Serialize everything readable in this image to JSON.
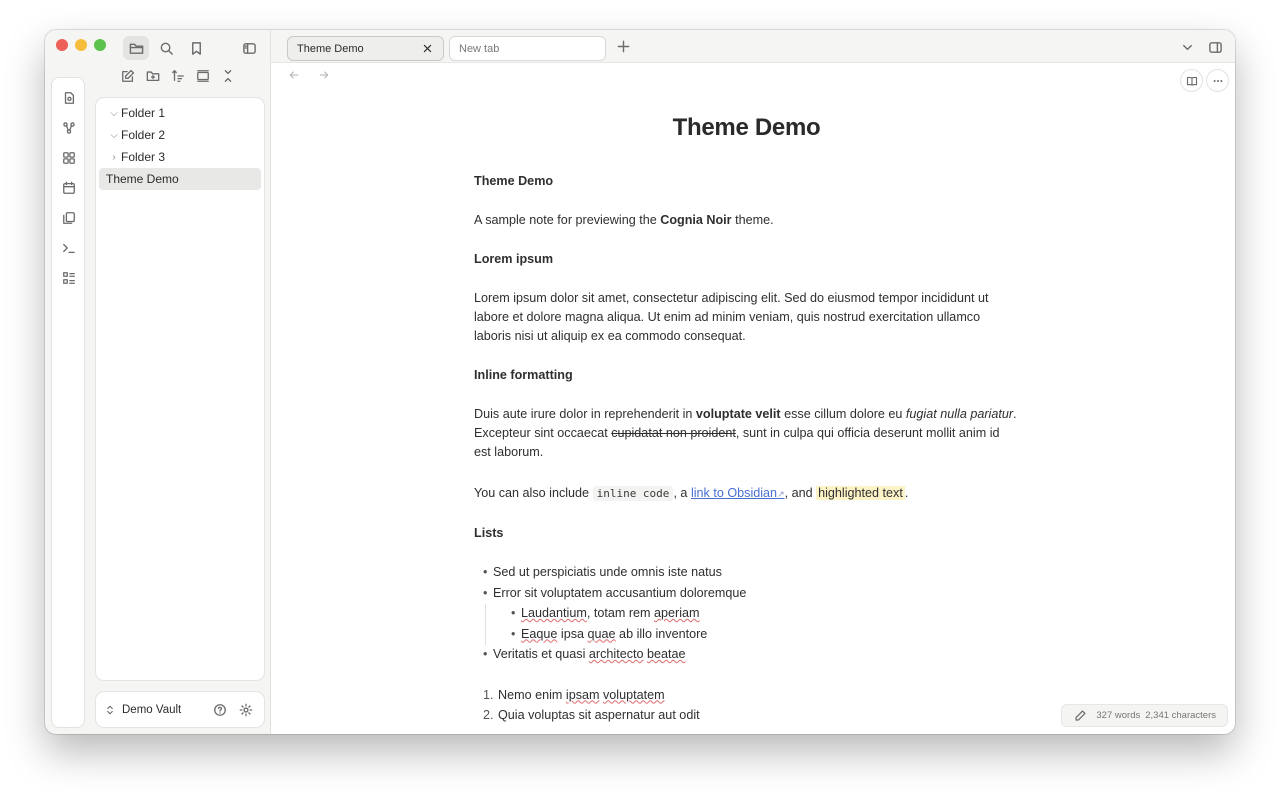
{
  "window": {
    "traffic_colors": [
      "#ee5f58",
      "#f6bd3b",
      "#5ac34d"
    ]
  },
  "top_icons": [
    "folder-icon",
    "search-icon",
    "bookmark-icon"
  ],
  "explorer_actions": [
    "new-note-icon",
    "new-folder-icon",
    "sort-icon",
    "auto-reveal-icon",
    "collapse-all-icon"
  ],
  "ribbon_icons": [
    "open-quick-switcher-icon",
    "graph-view-icon",
    "canvas-icon",
    "daily-note-icon",
    "templates-icon",
    "command-palette-icon",
    "bases-icon"
  ],
  "file_tree": {
    "items": [
      {
        "label": "Folder 1",
        "chevron": "⌵"
      },
      {
        "label": "Folder 2",
        "chevron": "⌵"
      },
      {
        "label": "Folder 3",
        "chevron": "›"
      },
      {
        "label": "Theme Demo",
        "chevron": ""
      }
    ]
  },
  "vault": {
    "name": "Demo Vault"
  },
  "tabs": {
    "active_label": "Theme Demo",
    "inactive_label": "New tab"
  },
  "note": {
    "inline_title": "Theme Demo",
    "h_theme_demo": "Theme Demo",
    "intro_before": "A sample note for previewing the ",
    "intro_bold": "Cognia Noir",
    "intro_after": " theme.",
    "h_lorem": "Lorem ipsum",
    "lorem_para": "Lorem ipsum dolor sit amet, consectetur adipiscing elit. Sed do eiusmod tempor incididunt ut labore et dolore magna aliqua. Ut enim ad minim veniam, quis nostrud exercitation ullamco laboris nisi ut aliquip ex ea commodo consequat.",
    "h_inline": "Inline formatting",
    "inline_1": "Duis aute irure dolor in reprehenderit in ",
    "inline_bold": "voluptate velit",
    "inline_2": " esse cillum dolore eu ",
    "inline_italic": "fugiat nulla pariatur",
    "inline_3": ". Excepteur sint occaecat ",
    "inline_strike": "cupidatat non proident",
    "inline_4": ", sunt in culpa qui officia deserunt mollit anim id est laborum.",
    "also_1": "You can also include ",
    "also_code": "inline code",
    "also_2": ", a ",
    "also_link": "link to Obsidian",
    "also_3": ", and ",
    "also_mark": "highlighted text",
    "also_4": ".",
    "h_lists": "Lists",
    "bullets": [
      "Sed ut perspiciatis unde omnis iste natus",
      "Error sit voluptatem accusantium doloremque"
    ],
    "nested_1_a": "Laudantium",
    "nested_1_b": ", totam rem ",
    "nested_1_c": "aperiam",
    "nested_2_a": "Eaque",
    "nested_2_b": " ipsa ",
    "nested_2_c": "quae",
    "nested_2_d": " ab illo inventore",
    "bullet_3_a": "Veritatis et quasi ",
    "bullet_3_b": "architecto",
    "bullet_3_c": " ",
    "bullet_3_d": "beatae",
    "num_1_n": "1.",
    "num_1_a": "Nemo enim ",
    "num_1_b": "ipsam",
    "num_1_c": " ",
    "num_1_d": "voluptatem",
    "num_2_n": "2.",
    "num_2": "Quia voluptas sit aspernatur aut odit"
  },
  "status": {
    "words": "327 words",
    "characters": "2,341 characters"
  }
}
